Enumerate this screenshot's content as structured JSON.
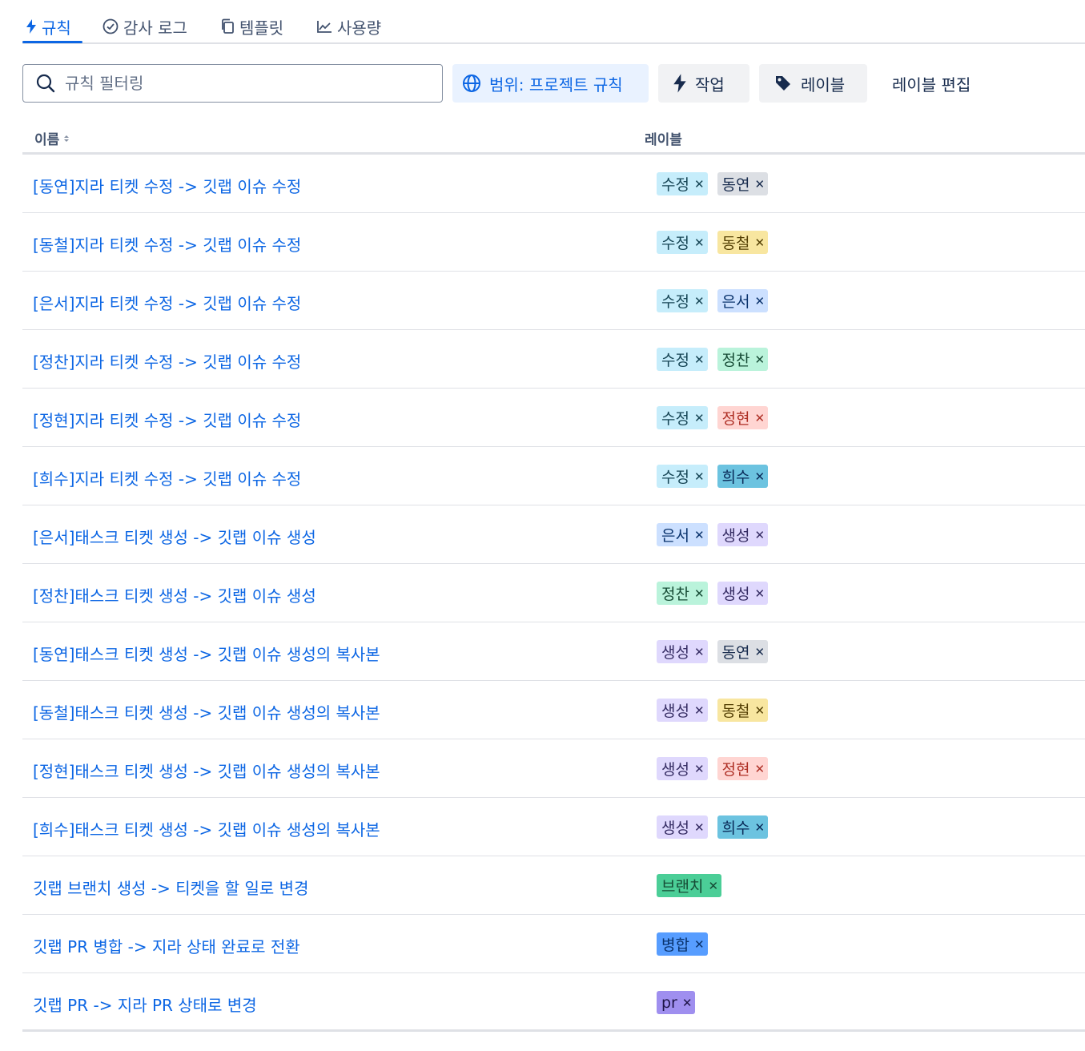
{
  "tabs": [
    {
      "label": "규칙",
      "icon": "lightning-icon",
      "active": true
    },
    {
      "label": "감사 로그",
      "icon": "check-circle-icon",
      "active": false
    },
    {
      "label": "템플릿",
      "icon": "copy-icon",
      "active": false
    },
    {
      "label": "사용량",
      "icon": "chart-line-icon",
      "active": false
    }
  ],
  "search": {
    "placeholder": "규칙 필터링",
    "value": ""
  },
  "toolbar": {
    "scope_label": "범위: 프로젝트 규칙",
    "action_label": "작업",
    "label_button": "레이블",
    "edit_labels": "레이블 편집"
  },
  "table": {
    "col_name": "이름",
    "col_labels": "레이블",
    "rows": [
      {
        "name": "[동연]지라 티켓 수정 -> 깃랩 이슈 수정",
        "labels": [
          "수정",
          "동연"
        ]
      },
      {
        "name": "[동철]지라 티켓 수정 -> 깃랩 이슈 수정",
        "labels": [
          "수정",
          "동철"
        ]
      },
      {
        "name": "[은서]지라 티켓 수정 -> 깃랩 이슈 수정",
        "labels": [
          "수정",
          "은서"
        ]
      },
      {
        "name": "[정찬]지라 티켓 수정 -> 깃랩 이슈 수정",
        "labels": [
          "수정",
          "정찬"
        ]
      },
      {
        "name": "[정현]지라 티켓 수정 -> 깃랩 이슈 수정",
        "labels": [
          "수정",
          "정현"
        ]
      },
      {
        "name": "[희수]지라 티켓 수정 -> 깃랩 이슈 수정",
        "labels": [
          "수정",
          "희수"
        ]
      },
      {
        "name": "[은서]태스크 티켓 생성 -> 깃랩 이슈 생성",
        "labels": [
          "은서",
          "생성"
        ]
      },
      {
        "name": "[정찬]태스크 티켓 생성 -> 깃랩 이슈 생성",
        "labels": [
          "정찬",
          "생성"
        ]
      },
      {
        "name": "[동연]태스크 티켓 생성 -> 깃랩 이슈 생성의 복사본",
        "labels": [
          "생성",
          "동연"
        ]
      },
      {
        "name": "[동철]태스크 티켓 생성 -> 깃랩 이슈 생성의 복사본",
        "labels": [
          "생성",
          "동철"
        ]
      },
      {
        "name": "[정현]태스크 티켓 생성 -> 깃랩 이슈 생성의 복사본",
        "labels": [
          "생성",
          "정현"
        ]
      },
      {
        "name": "[희수]태스크 티켓 생성 -> 깃랩 이슈 생성의 복사본",
        "labels": [
          "생성",
          "희수"
        ]
      },
      {
        "name": "깃랩 브랜치 생성 -> 티켓을 할 일로 변경",
        "labels": [
          "브랜치"
        ]
      },
      {
        "name": "깃랩 PR 병합 -> 지라 상태 완료로 전환",
        "labels": [
          "병합"
        ]
      },
      {
        "name": "깃랩 PR -> 지라 PR 상태로 변경",
        "labels": [
          "pr"
        ]
      }
    ]
  },
  "label_colors": {
    "수정": {
      "bg": "#c6edfb",
      "fg": "#164555"
    },
    "동연": {
      "bg": "#dcdfe4",
      "fg": "#172b4d"
    },
    "동철": {
      "bg": "#f8e6a0",
      "fg": "#533f04"
    },
    "은서": {
      "bg": "#cce0ff",
      "fg": "#09326c"
    },
    "정찬": {
      "bg": "#baf3db",
      "fg": "#164b35"
    },
    "정현": {
      "bg": "#ffd5d2",
      "fg": "#ae2e24"
    },
    "희수": {
      "bg": "#6cc3e0",
      "fg": "#092957"
    },
    "생성": {
      "bg": "#dfd8fd",
      "fg": "#352c63"
    },
    "브랜치": {
      "bg": "#4bce97",
      "fg": "#164b35"
    },
    "병합": {
      "bg": "#579dff",
      "fg": "#09326c"
    },
    "pr": {
      "bg": "#9f8fef",
      "fg": "#1d1446"
    }
  }
}
